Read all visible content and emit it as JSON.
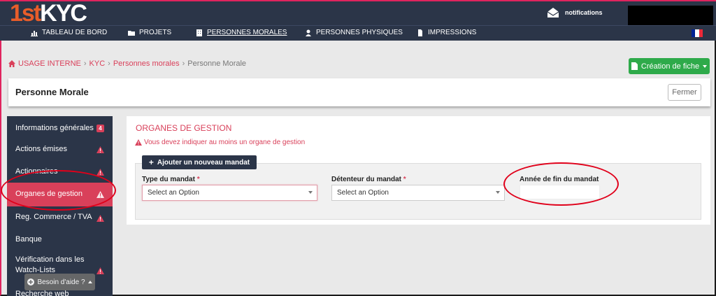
{
  "app": {
    "logo_part1": "1st",
    "logo_part2": "KYC",
    "notifications_label": "notifications"
  },
  "nav": {
    "items": [
      {
        "label": "TABLEAU DE BORD",
        "icon": "bar-chart-icon"
      },
      {
        "label": "PROJETS",
        "icon": "folder-icon"
      },
      {
        "label": "PERSONNES MORALES",
        "icon": "building-icon"
      },
      {
        "label": "PERSONNES PHYSIQUES",
        "icon": "user-icon"
      },
      {
        "label": "IMPRESSIONS",
        "icon": "file-icon"
      }
    ],
    "active_index": 2,
    "flag_colors": [
      "#002395",
      "#ffffff",
      "#ed2939"
    ]
  },
  "breadcrumb": {
    "items": [
      "USAGE INTERNE",
      "KYC",
      "Personnes morales"
    ],
    "current": "Personne Morale"
  },
  "create_button_label": "Création de fiche",
  "header": {
    "title": "Personne Morale",
    "close_label": "Fermer"
  },
  "sidebar": {
    "items": [
      {
        "label": "Informations générales",
        "badge": "4"
      },
      {
        "label": "Actions émises",
        "warning": true
      },
      {
        "label": "Actionnaires",
        "warning": true
      },
      {
        "label": "Organes de gestion",
        "warning": true,
        "active": true
      },
      {
        "label": "Reg. Commerce / TVA",
        "warning": true
      },
      {
        "label": "Banque"
      },
      {
        "label": "Vérification dans les Watch-Lists",
        "warning": true
      },
      {
        "label": "Recherche web"
      }
    ],
    "help_label": "Besoin d'aide ?"
  },
  "main": {
    "section_title": "ORGANES DE GESTION",
    "warning_text": "Vous devez indiquer au moins un organe de gestion",
    "add_button_label": "Ajouter un nouveau mandat",
    "fields": {
      "type_label": "Type du mandat",
      "type_placeholder": "Select an Option",
      "holder_label": "Détenteur du mandat",
      "holder_placeholder": "Select an Option",
      "end_year_label": "Année de fin du mandat",
      "end_year_value": ""
    },
    "required_mark": "*"
  },
  "colors": {
    "brand_dark": "#2b3548",
    "accent_red": "#d9405a",
    "success_green": "#2eaa4a",
    "annotation_red": "#e0001a"
  }
}
